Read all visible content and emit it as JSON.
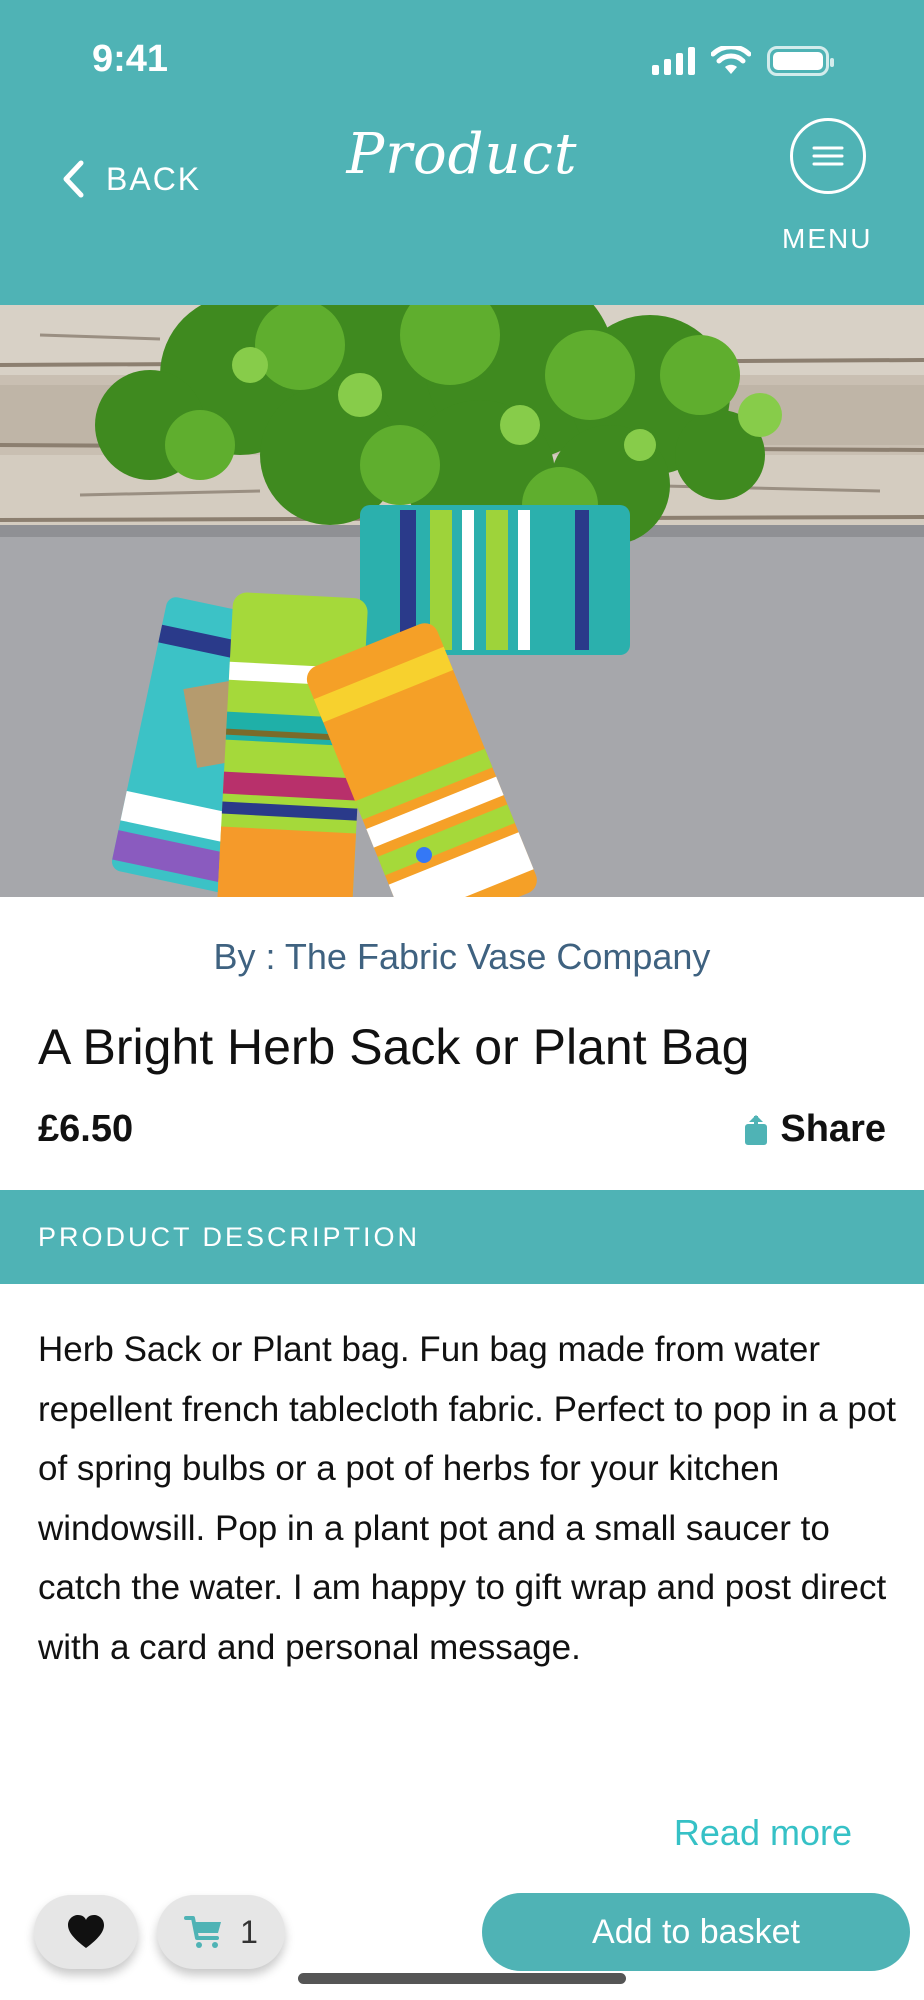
{
  "status_bar": {
    "time": "9:41"
  },
  "nav": {
    "back_label": "BACK",
    "title": "Product",
    "menu_label": "MENU"
  },
  "product": {
    "vendor": "By : The Fabric Vase Company",
    "title": "A Bright Herb Sack or Plant Bag",
    "price": "£6.50",
    "share_label": "Share",
    "description_header": "PRODUCT DESCRIPTION",
    "description": "Herb Sack or Plant bag. Fun bag made from water repellent french tablecloth fabric. Perfect to pop in a pot of spring bulbs or a pot of herbs for your kitchen windowsill. Pop in a plant pot and a small saucer to catch the water. I am happy to gift wrap and post direct with a card and personal message.",
    "read_more_label": "Read more"
  },
  "bottom_bar": {
    "cart_count": "1",
    "add_to_basket_label": "Add to basket"
  },
  "icons": {
    "signal": "signal-icon",
    "wifi": "wifi-icon",
    "battery": "battery-icon",
    "back": "chevron-left-icon",
    "menu": "hamburger-icon",
    "share": "share-icon",
    "favorite": "heart-icon",
    "cart": "cart-icon"
  },
  "colors": {
    "accent": "#4fb3b5",
    "vendor_text": "#3f6280",
    "read_more": "#36c1c6",
    "carousel_dot": "#3478f6"
  }
}
